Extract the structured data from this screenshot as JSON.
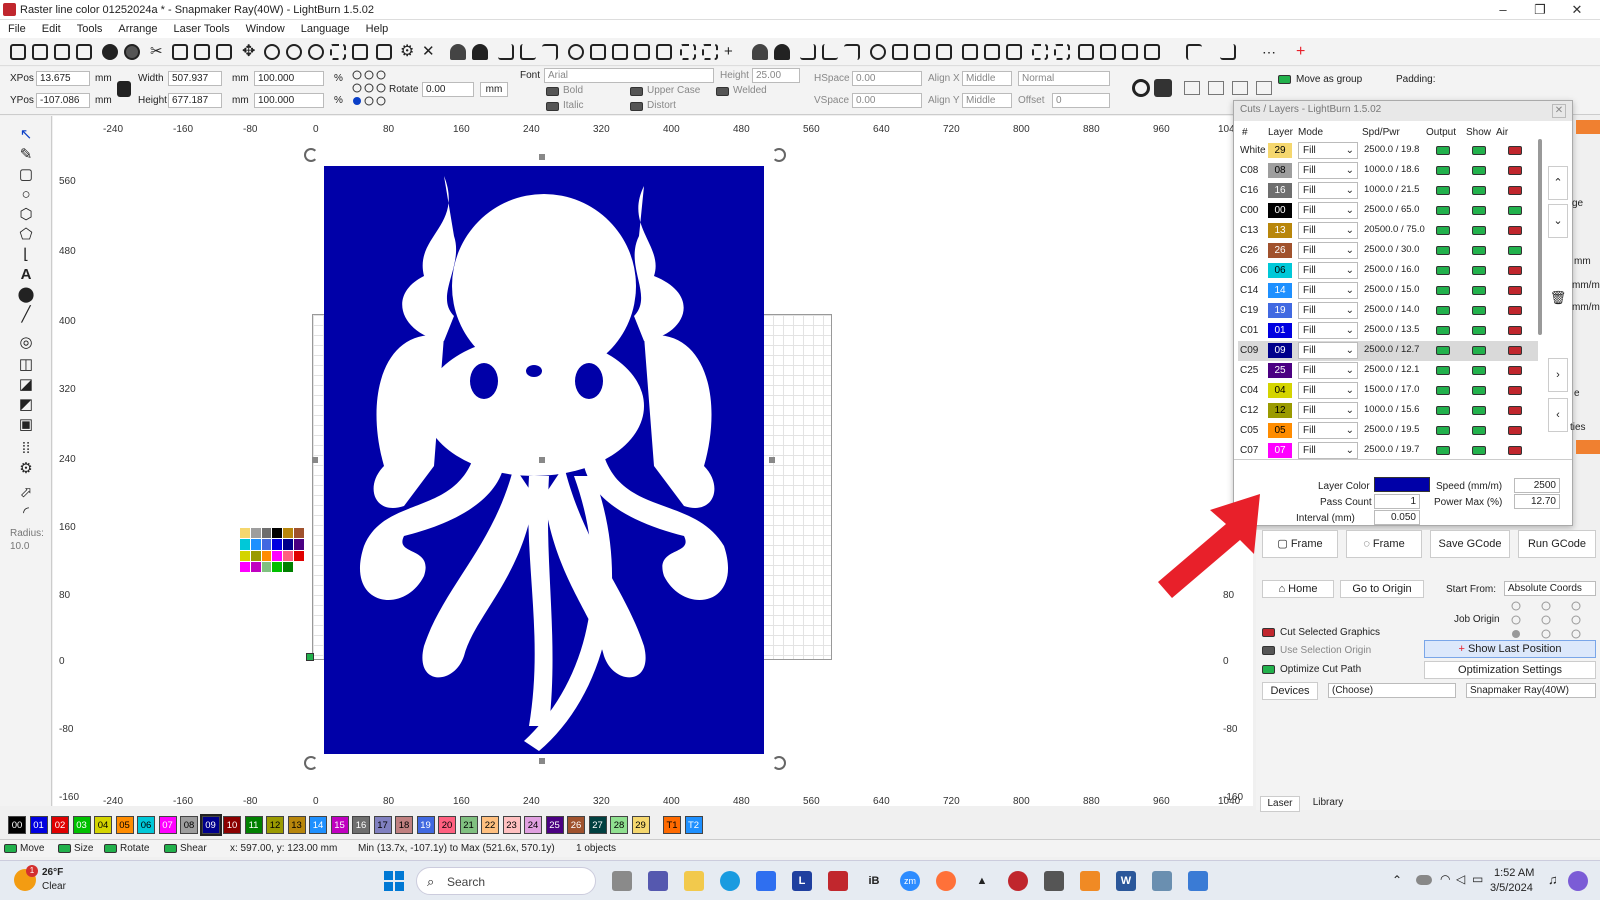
{
  "window": {
    "title": "Raster line color 01252024a * - Snapmaker Ray(40W) - LightBurn 1.5.02",
    "minimize": "–",
    "maximize": "❐",
    "close": "✕"
  },
  "menu": [
    "File",
    "Edit",
    "Tools",
    "Arrange",
    "Laser Tools",
    "Window",
    "Language",
    "Help"
  ],
  "numeric": {
    "xpos_label": "XPos",
    "xpos": "13.675",
    "ypos_label": "YPos",
    "ypos": "-107.086",
    "unit": "mm",
    "width_label": "Width",
    "width": "507.937",
    "height_label": "Height",
    "height": "677.187",
    "pct1": "100.000",
    "pct2": "100.000",
    "pct_sym": "%",
    "rotate_label": "Rotate",
    "rotate": "0.00",
    "mm_btn": "mm"
  },
  "text_tools": {
    "font_label": "Font",
    "font": "Arial",
    "height_label": "Height",
    "height": "25.00",
    "hspace_label": "HSpace",
    "hspace": "0.00",
    "vspace_label": "VSpace",
    "vspace": "0.00",
    "alignx_label": "Align X",
    "alignx": "Middle",
    "aligny_label": "Align Y",
    "aligny": "Middle",
    "normal": "Normal",
    "offset_label": "Offset",
    "offset": "0",
    "bold": "Bold",
    "italic": "Italic",
    "upper": "Upper Case",
    "welded": "Welded",
    "distort": "Distort",
    "move_as_group": "Move as group",
    "padding": "Padding:"
  },
  "left_tools": {
    "radius_label": "Radius:",
    "radius": "10.0"
  },
  "ruler_top": [
    "-240",
    "-160",
    "-80",
    "0",
    "80",
    "160",
    "240",
    "320",
    "400",
    "480",
    "560",
    "640",
    "720",
    "800",
    "880",
    "960",
    "1040"
  ],
  "ruler_left": [
    "560",
    "480",
    "400",
    "320",
    "240",
    "160",
    "80",
    "0",
    "-80",
    "-160"
  ],
  "ruler_right": [
    "80",
    "0",
    "-80",
    "-160"
  ],
  "cuts": {
    "title": "Cuts / Layers - LightBurn 1.5.02",
    "headers": [
      "#",
      "Layer",
      "Mode",
      "Spd/Pwr",
      "Output",
      "Show",
      "Air"
    ],
    "rows": [
      {
        "name": "White",
        "num": "29",
        "color": "#f5d76e",
        "mode": "Fill",
        "sp": "2500.0 / 19.8",
        "air": "off"
      },
      {
        "name": "C08",
        "num": "08",
        "color": "#9e9e9e",
        "mode": "Fill",
        "sp": "1000.0 / 18.6",
        "air": "off"
      },
      {
        "name": "C16",
        "num": "16",
        "color": "#6e6e6e",
        "mode": "Fill",
        "sp": "1000.0 / 21.5",
        "air": "off"
      },
      {
        "name": "C00",
        "num": "00",
        "color": "#000000",
        "mode": "Fill",
        "sp": "2500.0 / 65.0",
        "air": "on"
      },
      {
        "name": "C13",
        "num": "13",
        "color": "#b8860b",
        "mode": "Fill",
        "sp": "20500.0 / 75.0",
        "air": "off"
      },
      {
        "name": "C26",
        "num": "26",
        "color": "#a0522d",
        "mode": "Fill",
        "sp": "2500.0 / 30.0",
        "air": "on"
      },
      {
        "name": "C06",
        "num": "06",
        "color": "#00c8d8",
        "mode": "Fill",
        "sp": "2500.0 / 16.0",
        "air": "off"
      },
      {
        "name": "C14",
        "num": "14",
        "color": "#1e90ff",
        "mode": "Fill",
        "sp": "2500.0 / 15.0",
        "air": "off"
      },
      {
        "name": "C19",
        "num": "19",
        "color": "#4169e1",
        "mode": "Fill",
        "sp": "2500.0 / 14.0",
        "air": "off"
      },
      {
        "name": "C01",
        "num": "01",
        "color": "#0000e0",
        "mode": "Fill",
        "sp": "2500.0 / 13.5",
        "air": "off"
      },
      {
        "name": "C09",
        "num": "09",
        "color": "#00008b",
        "mode": "Fill",
        "sp": "2500.0 / 12.7",
        "air": "off"
      },
      {
        "name": "C25",
        "num": "25",
        "color": "#4b0082",
        "mode": "Fill",
        "sp": "2500.0 / 12.1",
        "air": "off"
      },
      {
        "name": "C04",
        "num": "04",
        "color": "#d4d400",
        "mode": "Fill",
        "sp": "1500.0 / 17.0",
        "air": "off"
      },
      {
        "name": "C12",
        "num": "12",
        "color": "#9a9a00",
        "mode": "Fill",
        "sp": "1000.0 / 15.6",
        "air": "off"
      },
      {
        "name": "C05",
        "num": "05",
        "color": "#ff8c00",
        "mode": "Fill",
        "sp": "2500.0 / 19.5",
        "air": "off"
      },
      {
        "name": "C07",
        "num": "07",
        "color": "#ff00ff",
        "mode": "Fill",
        "sp": "2500.0 / 19.7",
        "air": "off"
      }
    ],
    "layer_color_label": "Layer Color",
    "layer_color": "#0000a8",
    "speed_label": "Speed (mm/m)",
    "speed": "2500",
    "pass_label": "Pass Count",
    "pass": "1",
    "power_label": "Power Max (%)",
    "power": "12.70",
    "interval_label": "Interval (mm)",
    "interval": "0.050"
  },
  "laser": {
    "frame1": "Frame",
    "frame2": "Frame",
    "save": "Save GCode",
    "run": "Run GCode",
    "home": "Home",
    "goto": "Go to Origin",
    "start_from_label": "Start From:",
    "start_from": "Absolute Coords",
    "job_origin": "Job Origin",
    "cut_selected": "Cut Selected Graphics",
    "use_selection": "Use Selection Origin",
    "optimize": "Optimize Cut Path",
    "show_last": "Show Last Position",
    "opt_settings": "Optimization Settings",
    "devices": "Devices",
    "choose": "(Choose)",
    "device": "Snapmaker Ray(40W)",
    "tab_laser": "Laser",
    "tab_library": "Library",
    "side_mm1": "mm",
    "side_mm2": "mm/m",
    "side_mm3": "mm/m",
    "side_ge": "ge",
    "side_ties": "ties",
    "side_e": "e"
  },
  "palette": [
    {
      "l": "00",
      "c": "#000000",
      "f": "#fff"
    },
    {
      "l": "01",
      "c": "#0000e0",
      "f": "#fff"
    },
    {
      "l": "02",
      "c": "#e00000",
      "f": "#fff"
    },
    {
      "l": "03",
      "c": "#00c000",
      "f": "#fff"
    },
    {
      "l": "04",
      "c": "#d4d400",
      "f": "#000"
    },
    {
      "l": "05",
      "c": "#ff8c00",
      "f": "#000"
    },
    {
      "l": "06",
      "c": "#00c8d8",
      "f": "#000"
    },
    {
      "l": "07",
      "c": "#ff00ff",
      "f": "#fff"
    },
    {
      "l": "08",
      "c": "#9e9e9e",
      "f": "#000"
    },
    {
      "l": "09",
      "c": "#00008b",
      "f": "#fff"
    },
    {
      "l": "10",
      "c": "#8b0000",
      "f": "#fff"
    },
    {
      "l": "11",
      "c": "#008000",
      "f": "#fff"
    },
    {
      "l": "12",
      "c": "#9a9a00",
      "f": "#000"
    },
    {
      "l": "13",
      "c": "#b8860b",
      "f": "#000"
    },
    {
      "l": "14",
      "c": "#1e90ff",
      "f": "#fff"
    },
    {
      "l": "15",
      "c": "#c000c0",
      "f": "#fff"
    },
    {
      "l": "16",
      "c": "#6e6e6e",
      "f": "#fff"
    },
    {
      "l": "17",
      "c": "#8080c0",
      "f": "#000"
    },
    {
      "l": "18",
      "c": "#c08080",
      "f": "#000"
    },
    {
      "l": "19",
      "c": "#4169e1",
      "f": "#fff"
    },
    {
      "l": "20",
      "c": "#ff6080",
      "f": "#000"
    },
    {
      "l": "21",
      "c": "#80c080",
      "f": "#000"
    },
    {
      "l": "22",
      "c": "#ffc080",
      "f": "#000"
    },
    {
      "l": "23",
      "c": "#ffc0c0",
      "f": "#000"
    },
    {
      "l": "24",
      "c": "#e0a0e0",
      "f": "#000"
    },
    {
      "l": "25",
      "c": "#4b0082",
      "f": "#fff"
    },
    {
      "l": "26",
      "c": "#a0522d",
      "f": "#fff"
    },
    {
      "l": "27",
      "c": "#004040",
      "f": "#fff"
    },
    {
      "l": "28",
      "c": "#90e090",
      "f": "#000"
    },
    {
      "l": "29",
      "c": "#f5d76e",
      "f": "#000"
    },
    {
      "l": "T1",
      "c": "#ff6a00",
      "f": "#000"
    },
    {
      "l": "T2",
      "c": "#1e90ff",
      "f": "#fff"
    }
  ],
  "status": {
    "move": "Move",
    "size": "Size",
    "rotate": "Rotate",
    "shear": "Shear",
    "coords": "x: 597.00, y: 123.00 mm",
    "range": "Min (13.7x, -107.1y) to Max (521.6x, 570.1y)",
    "objects": "1 objects"
  },
  "taskbar": {
    "temp": "26°F",
    "weather": "Clear",
    "badge": "1",
    "search": "Search",
    "time": "1:52 AM",
    "date": "3/5/2024"
  },
  "colors": {
    "accent": "#0000a8",
    "arrow": "#e8202a"
  }
}
